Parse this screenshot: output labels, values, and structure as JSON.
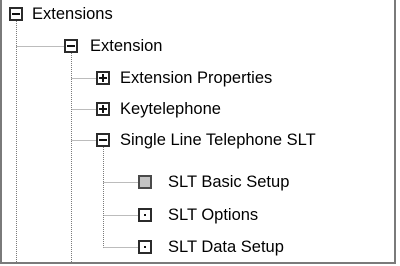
{
  "tree": {
    "nodes": [
      {
        "label": "Extensions",
        "state": "expanded",
        "level": 0
      },
      {
        "label": "Extension",
        "state": "expanded",
        "level": 1
      },
      {
        "label": "Extension Properties",
        "state": "collapsed",
        "level": 2
      },
      {
        "label": "Keytelephone",
        "state": "collapsed",
        "level": 2
      },
      {
        "label": "Single Line Telephone SLT",
        "state": "expanded",
        "level": 2
      },
      {
        "label": "SLT Basic Setup",
        "state": "leaf",
        "level": 3,
        "selected": true
      },
      {
        "label": "SLT Options",
        "state": "leaf",
        "level": 3
      },
      {
        "label": "SLT Data Setup",
        "state": "leaf",
        "level": 3
      }
    ]
  }
}
